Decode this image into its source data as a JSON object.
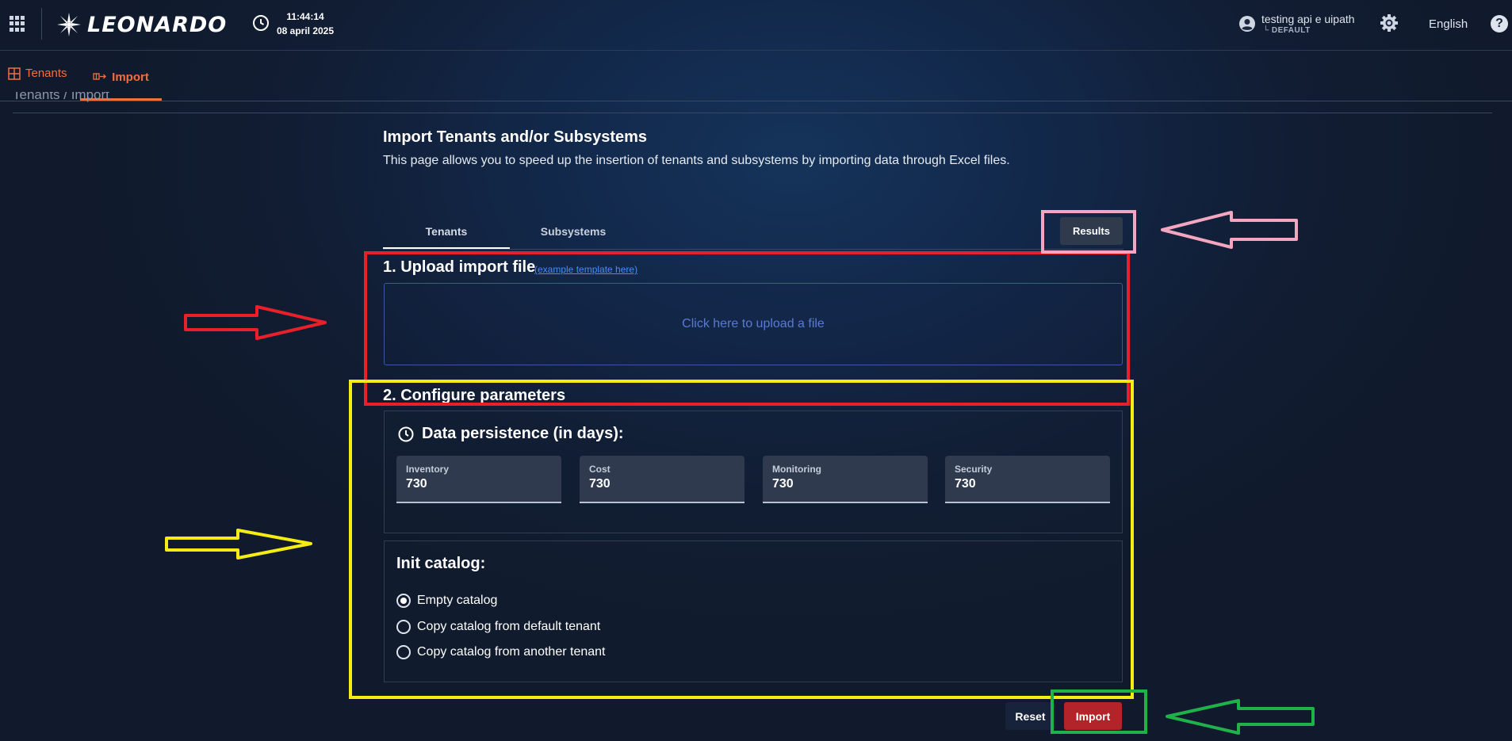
{
  "header": {
    "brand": "LEONARDO",
    "time": "11:44:14",
    "date": "08 april 2025",
    "user_name": "testing api e uipath",
    "user_tenant": "└ DEFAULT",
    "language": "English",
    "help_glyph": "?"
  },
  "nav": {
    "tenants_label": "Tenants",
    "import_label": "Import"
  },
  "breadcrumb": {
    "text": "Tenants / Import"
  },
  "page": {
    "title": "Import Tenants and/or Subsystems",
    "description": "This page allows you to speed up the insertion of tenants and subsystems by importing data through Excel files.",
    "tabs": [
      {
        "label": "Tenants",
        "active": true
      },
      {
        "label": "Subsystems",
        "active": false
      }
    ],
    "results_label": "Results"
  },
  "upload": {
    "heading": "1. Upload import file",
    "template_link": "(example template here)",
    "dropzone_text": "Click here to upload a file"
  },
  "config": {
    "heading": "2. Configure parameters",
    "persistence_title": "Data persistence (in days):",
    "fields": [
      {
        "label": "Inventory",
        "value": "730"
      },
      {
        "label": "Cost",
        "value": "730"
      },
      {
        "label": "Monitoring",
        "value": "730"
      },
      {
        "label": "Security",
        "value": "730"
      }
    ],
    "catalog_title": "Init catalog:",
    "catalog_options": [
      {
        "label": "Empty catalog",
        "checked": true
      },
      {
        "label": "Copy catalog from default tenant",
        "checked": false
      },
      {
        "label": "Copy catalog from another tenant",
        "checked": false
      }
    ]
  },
  "actions": {
    "reset_label": "Reset",
    "import_label": "Import"
  },
  "colors": {
    "accent": "#f0703f",
    "import_button": "#b3232a",
    "annotation_red": "#e8202a",
    "annotation_yellow": "#f5ec14",
    "annotation_pink": "#f4a6c0",
    "annotation_green": "#1fb24a"
  },
  "icons": [
    "apps-grid-icon",
    "clock-icon",
    "user-icon",
    "gear-icon",
    "help-icon",
    "tenants-icon",
    "import-icon",
    "history-icon",
    "radio-icon"
  ]
}
